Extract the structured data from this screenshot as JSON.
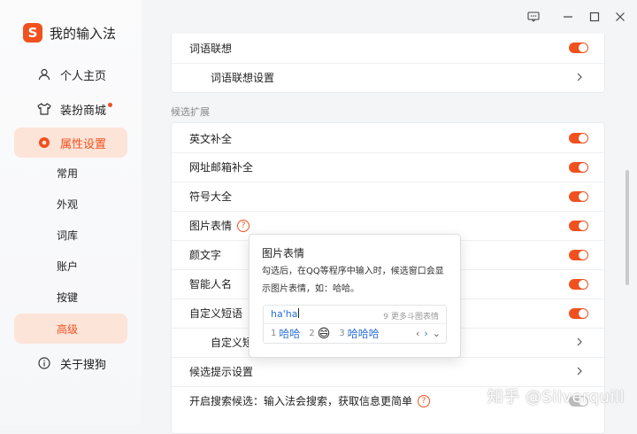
{
  "app": {
    "title": "我的输入法",
    "logo_letter": "S"
  },
  "sidebar": {
    "items": [
      {
        "label": "个人主页",
        "icon": "user-icon"
      },
      {
        "label": "装扮商城",
        "icon": "shirt-icon",
        "has_dot": true
      },
      {
        "label": "属性设置",
        "icon": "settings-icon",
        "active": true
      }
    ],
    "subitems": [
      {
        "label": "常用"
      },
      {
        "label": "外观"
      },
      {
        "label": "词库"
      },
      {
        "label": "账户"
      },
      {
        "label": "按键"
      },
      {
        "label": "高级",
        "active": true
      }
    ],
    "bottom_item": {
      "label": "关于搜狗",
      "icon": "info-icon"
    }
  },
  "settings": {
    "top_card": [
      {
        "label": "词语联想",
        "control": "toggle",
        "on": true
      },
      {
        "label": "词语联想设置",
        "control": "chevron"
      }
    ],
    "section_title": "候选扩展",
    "rows": [
      {
        "label": "英文补全",
        "control": "toggle",
        "on": true
      },
      {
        "label": "网址邮箱补全",
        "control": "toggle",
        "on": true
      },
      {
        "label": "符号大全",
        "control": "toggle",
        "on": true
      },
      {
        "label": "图片表情",
        "control": "toggle",
        "on": true,
        "help": true
      },
      {
        "label": "颜文字",
        "control": "toggle",
        "on": true
      },
      {
        "label": "智能人名",
        "control": "toggle",
        "on": true
      },
      {
        "label": "自定义短语",
        "control": "toggle",
        "on": true
      },
      {
        "label": "自定义短",
        "control": "chevron"
      },
      {
        "label": "候选提示设置",
        "control": "chevron"
      },
      {
        "label": "开启搜索候选：输入法会搜索，获取信息更简单",
        "control": "toggle",
        "help": true
      }
    ]
  },
  "popup": {
    "title": "图片表情",
    "description": "勾选后，在QQ等程序中输入时，候选窗口会显示图片表情，如：哈哈。",
    "candidate": {
      "pinyin": "ha'ha",
      "more_num": "9",
      "more_text": "更多斗图表情",
      "items": [
        {
          "num": "1",
          "text": "哈哈"
        },
        {
          "num": "2",
          "text": "😄"
        },
        {
          "num": "3",
          "text": "哈哈哈"
        }
      ]
    }
  },
  "watermark": "知乎 @Silverquill",
  "colors": {
    "accent": "#f0511f",
    "active_bg": "#fde4d8",
    "candidate_blue": "#2a6fd6"
  }
}
